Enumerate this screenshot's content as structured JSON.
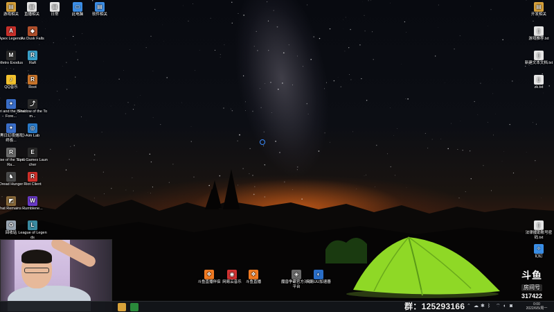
{
  "desktop_icons_left": [
    {
      "label": "游戏相关",
      "glyph": "▤",
      "color": "#d8a23a"
    },
    {
      "label": "直播相关",
      "glyph": "▤",
      "color": "#e6e6e6"
    },
    {
      "label": "日常",
      "glyph": "▤",
      "color": "#e6e6e6"
    },
    {
      "label": "此电脑",
      "glyph": "▭",
      "color": "#3c8ee6"
    },
    {
      "label": "软件相关",
      "glyph": "▤",
      "color": "#3c8ee6"
    },
    {
      "label": "Apex Legends",
      "glyph": "A",
      "color": "#c8302a"
    },
    {
      "label": "As Dusk Falls",
      "glyph": "◆",
      "color": "#b0502c"
    },
    {
      "label": "Metro Exodus",
      "glyph": "M",
      "color": "#2a2a2a"
    },
    {
      "label": "Raft",
      "glyph": "R",
      "color": "#3aa0c8"
    },
    {
      "label": "QQ音乐",
      "glyph": "♪",
      "color": "#f2c12e"
    },
    {
      "label": "Root",
      "glyph": "R",
      "color": "#c8742a"
    },
    {
      "label": "Ori and the Blind Fore...",
      "glyph": "✦",
      "color": "#3a6ec8"
    },
    {
      "label": "Shadow of the Tom...",
      "glyph": "⤴",
      "color": "#2a2a2a"
    },
    {
      "label": "《黑日幻夜傩戏》·终极...",
      "glyph": "✦",
      "color": "#3a6ec8"
    },
    {
      "label": "Aim Lab",
      "glyph": "◎",
      "color": "#2a7ac8"
    },
    {
      "label": "Rise of the Tomb Ra...",
      "glyph": "R",
      "color": "#6a6a6a"
    },
    {
      "label": "Epic Games Launcher",
      "glyph": "E",
      "color": "#2a2a2a"
    },
    {
      "label": "Dread Hunger",
      "glyph": "♞",
      "color": "#4a4a4a"
    },
    {
      "label": "Riot Client",
      "glyph": "R",
      "color": "#d0302a"
    },
    {
      "label": "What Remains ...",
      "glyph": "◩",
      "color": "#8a6a3a"
    },
    {
      "label": "Rumblene...",
      "glyph": "W",
      "color": "#6a3ac8"
    },
    {
      "label": "回收站",
      "glyph": "♻",
      "color": "#9aa6b2"
    },
    {
      "label": "League of Legends",
      "glyph": "L",
      "color": "#3a8aa0"
    }
  ],
  "desktop_icons_right": [
    {
      "label": "开发相关",
      "glyph": "▤",
      "color": "#d8a23a"
    },
    {
      "label": "游戏推荐.txt",
      "glyph": "▯",
      "color": "#e6e6e6"
    },
    {
      "label": "新建文本文档.txt",
      "glyph": "▯",
      "color": "#e6e6e6"
    },
    {
      "label": "zk.txt",
      "glyph": "▯",
      "color": "#e6e6e6"
    },
    {
      "label": "法律援助账号密码.txt",
      "glyph": "▯",
      "color": "#e6e6e6"
    },
    {
      "label": "幻幻",
      "glyph": "✧",
      "color": "#3a8ee6"
    }
  ],
  "desktop_icons_bottom": [
    {
      "label": "斗鱼直播伴侣",
      "glyph": "❖",
      "color": "#f07a22"
    },
    {
      "label": "网易云音乐",
      "glyph": "◉",
      "color": "#d23232"
    },
    {
      "label": "斗鱼直播",
      "glyph": "❖",
      "color": "#f07a22"
    },
    {
      "label": "魔兽争霸官方对战平台",
      "glyph": "◈",
      "color": "#6a6a6a"
    },
    {
      "label": "网易UU加速器",
      "glyph": "◐",
      "color": "#2a6ec8"
    }
  ],
  "overlay": {
    "group_text": "群：125293166",
    "douyu_brand": "斗鱼",
    "room_label": "房间号",
    "room_number": "317422"
  },
  "taskbar": {
    "clock_time": "0:00",
    "clock_date": "2022/6/5/周一"
  },
  "colors": {
    "taskbar_bg": "#14161a",
    "tent_green": "#9be02a",
    "cursor_ring": "#3a8cff"
  }
}
